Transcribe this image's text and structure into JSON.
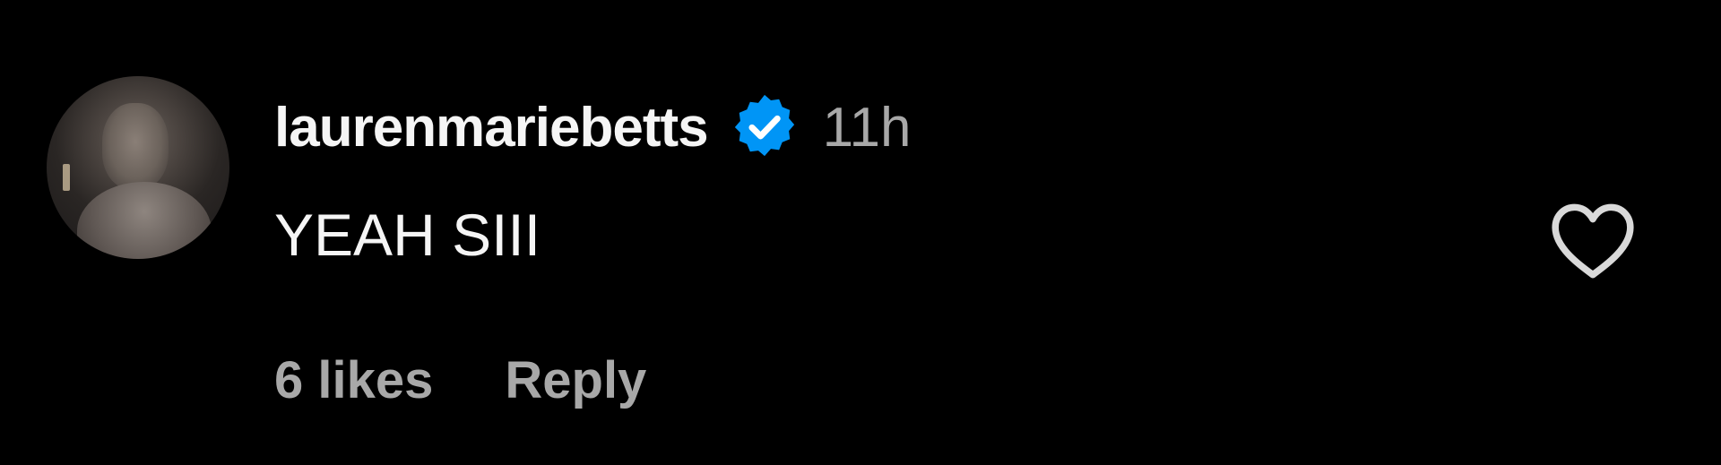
{
  "comment": {
    "username": "laurenmariebetts",
    "verified_icon": "verified-badge-icon",
    "timestamp": "11h",
    "text": "YEAH SIII",
    "likes": "6 likes",
    "reply_label": "Reply",
    "like_icon": "heart-icon"
  },
  "colors": {
    "background": "#000000",
    "primary_text": "#f5f5f5",
    "secondary_text": "#a8a8a8",
    "verified_blue": "#0095f6"
  }
}
